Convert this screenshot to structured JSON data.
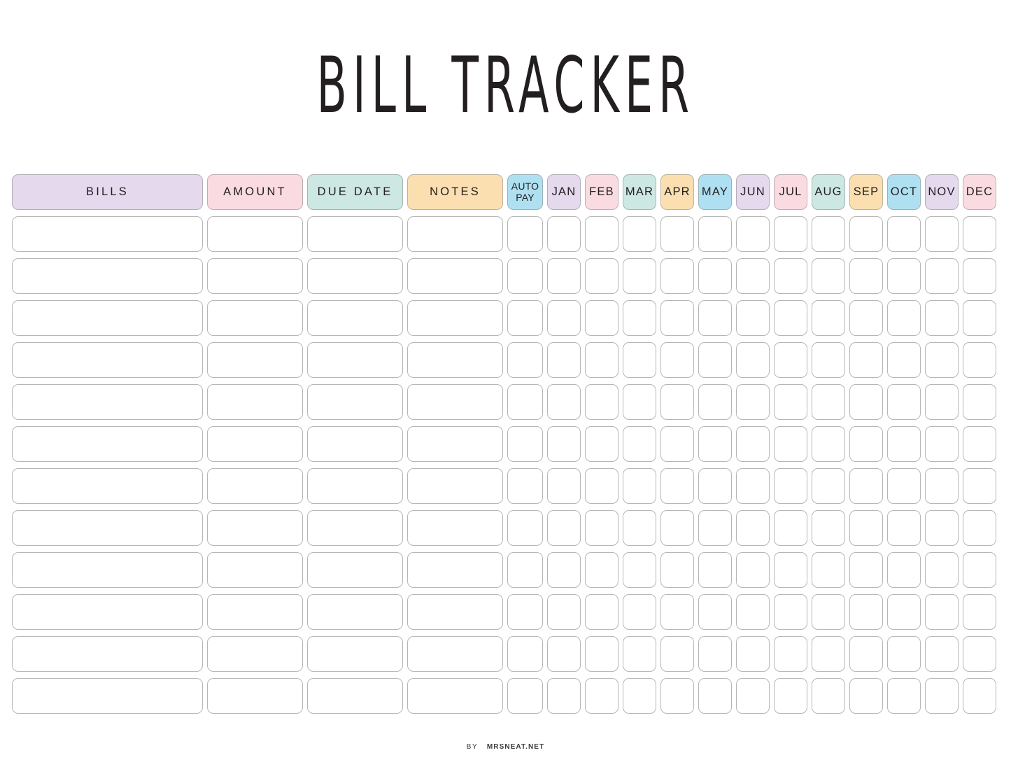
{
  "page": {
    "title": "BILL TRACKER",
    "background_color": "#ffffff",
    "text_color": "#231f20",
    "cell_border_color": "#b6b6b6"
  },
  "footer": {
    "by_label": "BY",
    "site_label": "MRSNEAT.NET"
  },
  "palette": {
    "lavender": "#e4d9ed",
    "pink": "#fadbe1",
    "mint": "#cde7e2",
    "peach": "#fcdfb0",
    "blue": "#afe0f2"
  },
  "table": {
    "row_count": 12,
    "columns": [
      {
        "key": "bills",
        "label": "BILLS",
        "color": "#e4d9ed",
        "type": "wide"
      },
      {
        "key": "amount",
        "label": "AMOUNT",
        "color": "#fadbe1",
        "type": "medium"
      },
      {
        "key": "due_date",
        "label": "DUE DATE",
        "color": "#cde7e2",
        "type": "medium"
      },
      {
        "key": "notes",
        "label": "NOTES",
        "color": "#fcdfb0",
        "type": "medium"
      },
      {
        "key": "auto_pay",
        "label": "AUTO PAY",
        "label_line1": "AUTO",
        "label_line2": "PAY",
        "color": "#afe0f2",
        "type": "autopay"
      },
      {
        "key": "jan",
        "label": "JAN",
        "color": "#e4d9ed",
        "type": "month"
      },
      {
        "key": "feb",
        "label": "FEB",
        "color": "#fadbe1",
        "type": "month"
      },
      {
        "key": "mar",
        "label": "MAR",
        "color": "#cde7e2",
        "type": "month"
      },
      {
        "key": "apr",
        "label": "APR",
        "color": "#fcdfb0",
        "type": "month"
      },
      {
        "key": "may",
        "label": "MAY",
        "color": "#afe0f2",
        "type": "month"
      },
      {
        "key": "jun",
        "label": "JUN",
        "color": "#e4d9ed",
        "type": "month"
      },
      {
        "key": "jul",
        "label": "JUL",
        "color": "#fadbe1",
        "type": "month"
      },
      {
        "key": "aug",
        "label": "AUG",
        "color": "#cde7e2",
        "type": "month"
      },
      {
        "key": "sep",
        "label": "SEP",
        "color": "#fcdfb0",
        "type": "month"
      },
      {
        "key": "oct",
        "label": "OCT",
        "color": "#afe0f2",
        "type": "month"
      },
      {
        "key": "nov",
        "label": "NOV",
        "color": "#e4d9ed",
        "type": "month"
      },
      {
        "key": "dec",
        "label": "DEC",
        "color": "#fadbe1",
        "type": "month"
      }
    ],
    "rows": [
      {
        "bills": "",
        "amount": "",
        "due_date": "",
        "notes": "",
        "auto_pay": "",
        "jan": "",
        "feb": "",
        "mar": "",
        "apr": "",
        "may": "",
        "jun": "",
        "jul": "",
        "aug": "",
        "sep": "",
        "oct": "",
        "nov": "",
        "dec": ""
      },
      {
        "bills": "",
        "amount": "",
        "due_date": "",
        "notes": "",
        "auto_pay": "",
        "jan": "",
        "feb": "",
        "mar": "",
        "apr": "",
        "may": "",
        "jun": "",
        "jul": "",
        "aug": "",
        "sep": "",
        "oct": "",
        "nov": "",
        "dec": ""
      },
      {
        "bills": "",
        "amount": "",
        "due_date": "",
        "notes": "",
        "auto_pay": "",
        "jan": "",
        "feb": "",
        "mar": "",
        "apr": "",
        "may": "",
        "jun": "",
        "jul": "",
        "aug": "",
        "sep": "",
        "oct": "",
        "nov": "",
        "dec": ""
      },
      {
        "bills": "",
        "amount": "",
        "due_date": "",
        "notes": "",
        "auto_pay": "",
        "jan": "",
        "feb": "",
        "mar": "",
        "apr": "",
        "may": "",
        "jun": "",
        "jul": "",
        "aug": "",
        "sep": "",
        "oct": "",
        "nov": "",
        "dec": ""
      },
      {
        "bills": "",
        "amount": "",
        "due_date": "",
        "notes": "",
        "auto_pay": "",
        "jan": "",
        "feb": "",
        "mar": "",
        "apr": "",
        "may": "",
        "jun": "",
        "jul": "",
        "aug": "",
        "sep": "",
        "oct": "",
        "nov": "",
        "dec": ""
      },
      {
        "bills": "",
        "amount": "",
        "due_date": "",
        "notes": "",
        "auto_pay": "",
        "jan": "",
        "feb": "",
        "mar": "",
        "apr": "",
        "may": "",
        "jun": "",
        "jul": "",
        "aug": "",
        "sep": "",
        "oct": "",
        "nov": "",
        "dec": ""
      },
      {
        "bills": "",
        "amount": "",
        "due_date": "",
        "notes": "",
        "auto_pay": "",
        "jan": "",
        "feb": "",
        "mar": "",
        "apr": "",
        "may": "",
        "jun": "",
        "jul": "",
        "aug": "",
        "sep": "",
        "oct": "",
        "nov": "",
        "dec": ""
      },
      {
        "bills": "",
        "amount": "",
        "due_date": "",
        "notes": "",
        "auto_pay": "",
        "jan": "",
        "feb": "",
        "mar": "",
        "apr": "",
        "may": "",
        "jun": "",
        "jul": "",
        "aug": "",
        "sep": "",
        "oct": "",
        "nov": "",
        "dec": ""
      },
      {
        "bills": "",
        "amount": "",
        "due_date": "",
        "notes": "",
        "auto_pay": "",
        "jan": "",
        "feb": "",
        "mar": "",
        "apr": "",
        "may": "",
        "jun": "",
        "jul": "",
        "aug": "",
        "sep": "",
        "oct": "",
        "nov": "",
        "dec": ""
      },
      {
        "bills": "",
        "amount": "",
        "due_date": "",
        "notes": "",
        "auto_pay": "",
        "jan": "",
        "feb": "",
        "mar": "",
        "apr": "",
        "may": "",
        "jun": "",
        "jul": "",
        "aug": "",
        "sep": "",
        "oct": "",
        "nov": "",
        "dec": ""
      },
      {
        "bills": "",
        "amount": "",
        "due_date": "",
        "notes": "",
        "auto_pay": "",
        "jan": "",
        "feb": "",
        "mar": "",
        "apr": "",
        "may": "",
        "jun": "",
        "jul": "",
        "aug": "",
        "sep": "",
        "oct": "",
        "nov": "",
        "dec": ""
      },
      {
        "bills": "",
        "amount": "",
        "due_date": "",
        "notes": "",
        "auto_pay": "",
        "jan": "",
        "feb": "",
        "mar": "",
        "apr": "",
        "may": "",
        "jun": "",
        "jul": "",
        "aug": "",
        "sep": "",
        "oct": "",
        "nov": "",
        "dec": ""
      }
    ]
  }
}
